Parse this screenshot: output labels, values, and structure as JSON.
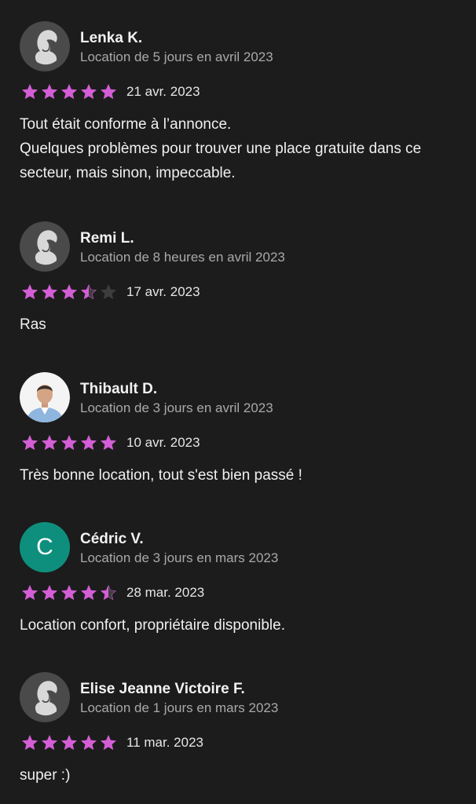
{
  "colors": {
    "background": "#1c1c1c",
    "star_filled": "#d45ed6",
    "star_empty": "#3d3d3d",
    "letter_avatar": "#0e8f7e"
  },
  "reviews": [
    {
      "avatar": "default-silhouette",
      "name": "Lenka K.",
      "subtitle": "Location de 5 jours en avril 2023",
      "rating": 5,
      "date": "21 avr. 2023",
      "text": "Tout était conforme à l’annonce.\nQuelques problèmes pour trouver une place gratuite dans ce secteur, mais sinon, impeccable."
    },
    {
      "avatar": "default-silhouette",
      "name": "Remi L.",
      "subtitle": "Location de 8 heures en avril 2023",
      "rating": 3.5,
      "date": "17 avr. 2023",
      "text": "Ras"
    },
    {
      "avatar": "photo",
      "name": "Thibault D.",
      "subtitle": "Location de 3 jours en avril 2023",
      "rating": 5,
      "date": "10 avr. 2023",
      "text": "Très bonne location, tout s'est bien passé !"
    },
    {
      "avatar": "letter",
      "avatar_letter": "C",
      "name": "Cédric V.",
      "subtitle": "Location de 3 jours en mars 2023",
      "rating": 4.5,
      "date": "28 mar. 2023",
      "text": "Location confort, propriétaire disponible."
    },
    {
      "avatar": "default-silhouette",
      "name": "Elise Jeanne Victoire F.",
      "subtitle": "Location de 1 jours en mars 2023",
      "rating": 5,
      "date": "11 mar. 2023",
      "text": "super :)"
    }
  ]
}
